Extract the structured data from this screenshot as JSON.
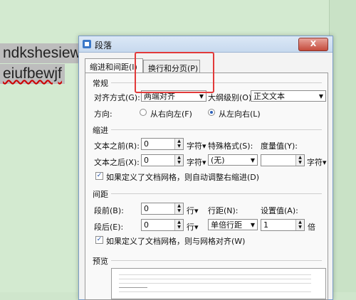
{
  "document": {
    "line1": "ndkshesiew",
    "line2": "eiufbewjf"
  },
  "dialog": {
    "title": "段落",
    "close_label": "X",
    "tabs": [
      "缩进和间距(I)",
      "换行和分页(P)"
    ],
    "general": {
      "section": "常规",
      "align_label": "对齐方式(G):",
      "align_value": "两端对齐",
      "outline_label": "大纲级别(O):",
      "outline_value": "正文文本",
      "direction_label": "方向:",
      "rtl_label": "从右向左(F)",
      "ltr_label": "从左向右(L)"
    },
    "indent": {
      "section": "缩进",
      "before_label": "文本之前(R):",
      "before_value": "0",
      "before_unit": "字符▾",
      "special_label": "特殊格式(S):",
      "measure_label": "度量值(Y):",
      "after_label": "文本之后(X):",
      "after_value": "0",
      "after_unit": "字符▾",
      "special_value": "(无)",
      "measure_unit": "字符▾",
      "grid_check": "如果定义了文档网格，则自动调整右缩进(D)"
    },
    "spacing": {
      "section": "间距",
      "before_label": "段前(B):",
      "before_value": "0",
      "before_unit": "行▾",
      "line_spacing_label": "行距(N):",
      "set_value_label": "设置值(A):",
      "after_label": "段后(E):",
      "after_value": "0",
      "after_unit": "行▾",
      "line_spacing_value": "单倍行距",
      "set_value": "1",
      "set_unit": "倍",
      "grid_check": "如果定义了文档网格，则与网格对齐(W)"
    },
    "preview": {
      "section": "预览"
    }
  },
  "colors": {
    "highlight": "#e23a3a",
    "accent": "#2b5fb8"
  }
}
